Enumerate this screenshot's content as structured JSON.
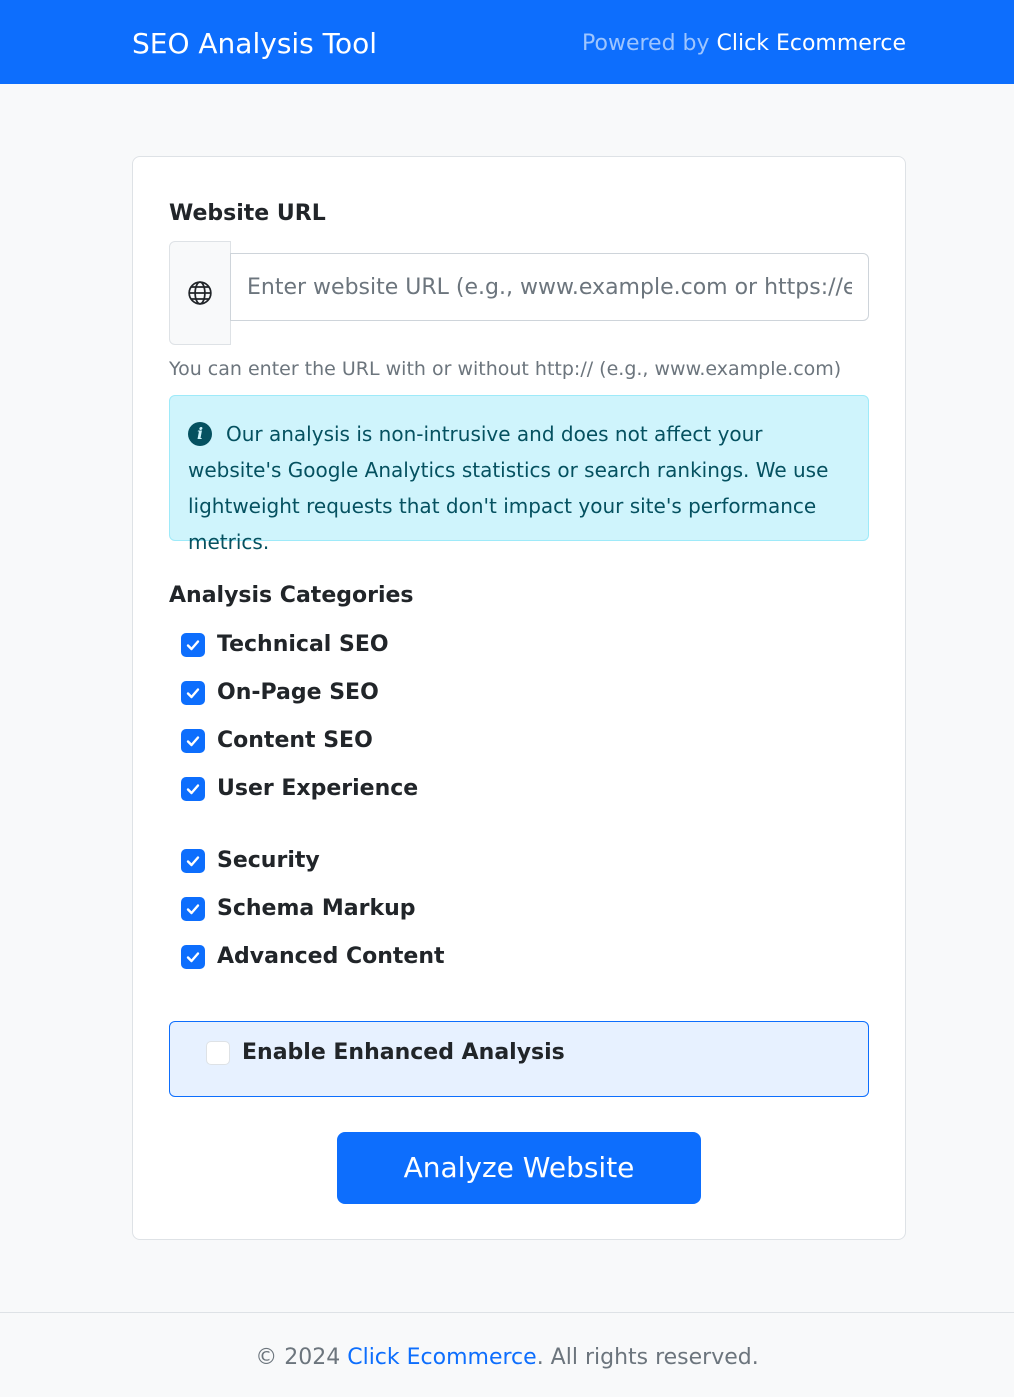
{
  "header": {
    "brand": "SEO Analysis Tool",
    "powered_prefix": "Powered by",
    "powered_link": "Click Ecommerce"
  },
  "form": {
    "url_label": "Website URL",
    "url_icon": "globe-icon",
    "url_placeholder": "Enter website URL (e.g., www.example.com or https://example.com)",
    "url_value": "",
    "help_text": "You can enter the URL with or without http:// (e.g., www.example.com)",
    "info_icon": "info-circle-icon",
    "notice": "Our analysis is non-intrusive and does not affect your website's Google Analytics statistics or search rankings. We use lightweight requests that don't impact your site's performance metrics.",
    "categories_title": "Analysis Categories",
    "categories": [
      {
        "label": "Technical SEO",
        "checked": true
      },
      {
        "label": "On-Page SEO",
        "checked": true
      },
      {
        "label": "Content SEO",
        "checked": true
      },
      {
        "label": "User Experience",
        "checked": true
      },
      {
        "label": "Security",
        "checked": true
      },
      {
        "label": "Schema Markup",
        "checked": true
      },
      {
        "label": "Advanced Content",
        "checked": true
      }
    ],
    "enhanced_label": "Enable Enhanced Analysis",
    "enhanced_checked": false,
    "submit_label": "Analyze Website"
  },
  "footer": {
    "prefix": "© 2024",
    "link": "Click Ecommerce",
    "suffix": ". All rights reserved."
  },
  "colors": {
    "primary": "#0d6efd",
    "info_bg": "#cff4fc",
    "info_text": "#055160",
    "enhanced_bg": "#e7f1ff"
  }
}
